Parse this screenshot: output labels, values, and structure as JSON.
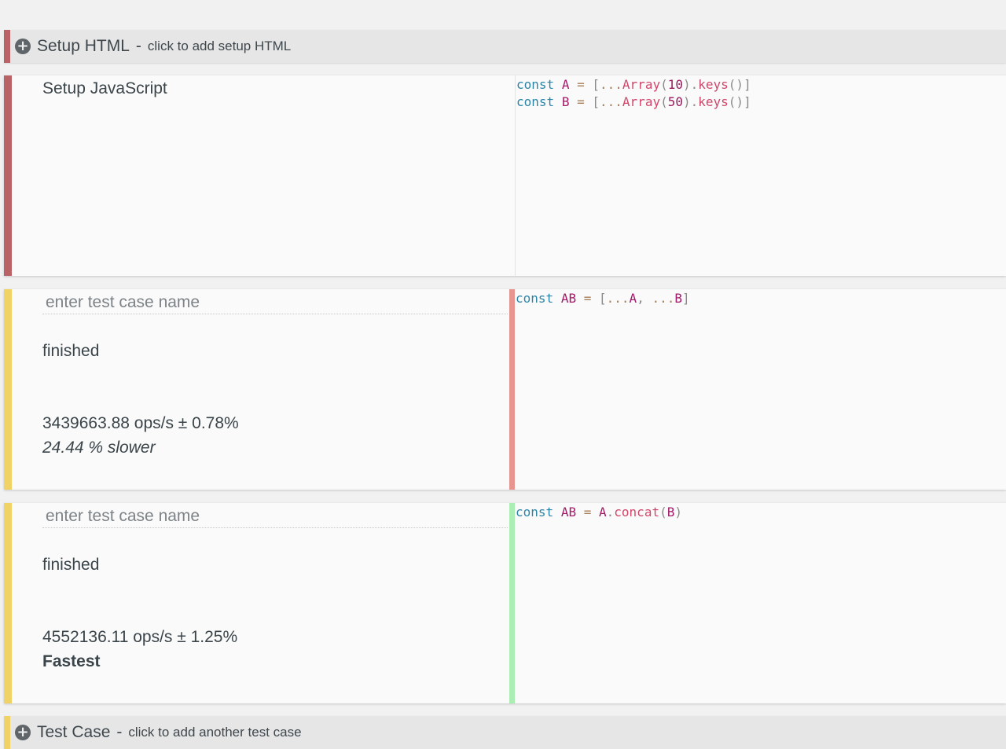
{
  "setup_html": {
    "title": "Setup HTML",
    "dash": "-",
    "hint": "click to add setup HTML",
    "accent": "#b96367"
  },
  "setup_js": {
    "label": "Setup JavaScript",
    "accent": "#b96367",
    "code": [
      "const A = [...Array(10).keys()]",
      "const B = [...Array(50).keys()]"
    ]
  },
  "test_cases": [
    {
      "name_placeholder": "enter test case name",
      "status": "finished",
      "ops": "3439663.88 ops/s ± 0.78%",
      "relative": "24.44 % slower",
      "code": "const AB = [...A, ...B]",
      "accent": "#f0d265",
      "result_color": "#e8958f"
    },
    {
      "name_placeholder": "enter test case name",
      "status": "finished",
      "ops": "4552136.11 ops/s ± 1.25%",
      "relative": "Fastest",
      "code": "const AB = A.concat(B)",
      "accent": "#f0d265",
      "result_color": "#abeeb3"
    }
  ],
  "add_test_case": {
    "title": "Test Case",
    "dash": "-",
    "hint": "click to add another test case",
    "accent": "#f0d265"
  },
  "icons": {
    "add": "plus-circle-icon"
  }
}
